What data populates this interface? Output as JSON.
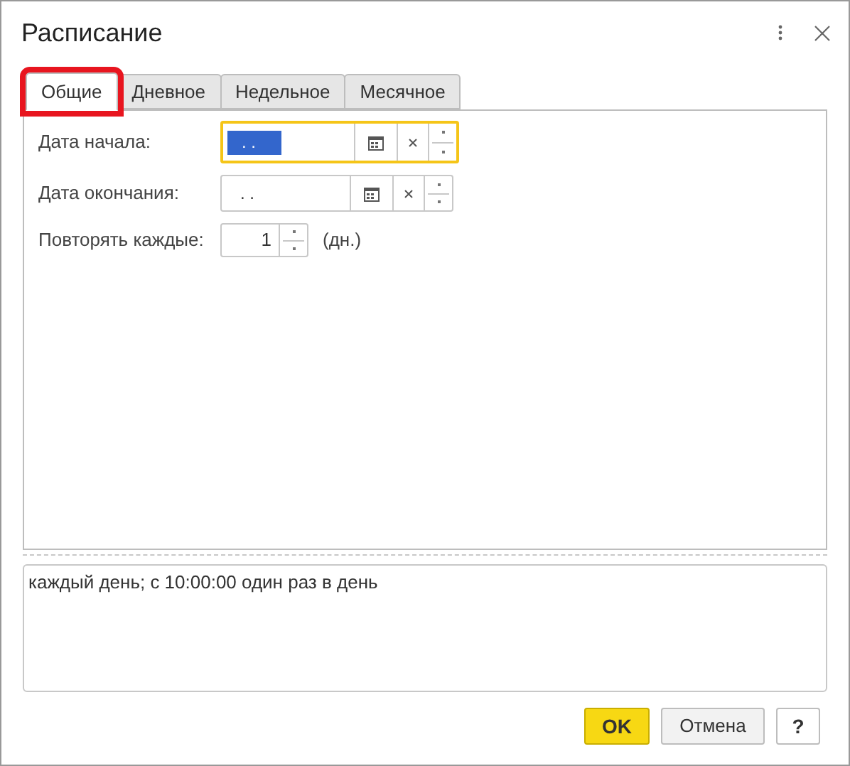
{
  "window": {
    "title": "Расписание"
  },
  "tabs": [
    {
      "label": "Общие",
      "selected": true,
      "highlighted": true
    },
    {
      "label": "Дневное",
      "selected": false,
      "highlighted": false
    },
    {
      "label": "Недельное",
      "selected": false,
      "highlighted": false
    },
    {
      "label": "Месячное",
      "selected": false,
      "highlighted": false
    }
  ],
  "fields": [
    {
      "kind": "date",
      "label": "Дата начала:",
      "value": ". .",
      "focused": true
    },
    {
      "kind": "date",
      "label": "Дата окончания:",
      "value": ". .",
      "focused": false
    },
    {
      "kind": "number",
      "label": "Повторять каждые:",
      "value": "1",
      "unit": "(дн.)"
    }
  ],
  "summary": "каждый день; с 10:00:00 один раз в день",
  "buttons": [
    {
      "kind": "primary",
      "label": "OK"
    },
    {
      "kind": "normal",
      "label": "Отмена"
    },
    {
      "kind": "help",
      "label": "?"
    }
  ]
}
